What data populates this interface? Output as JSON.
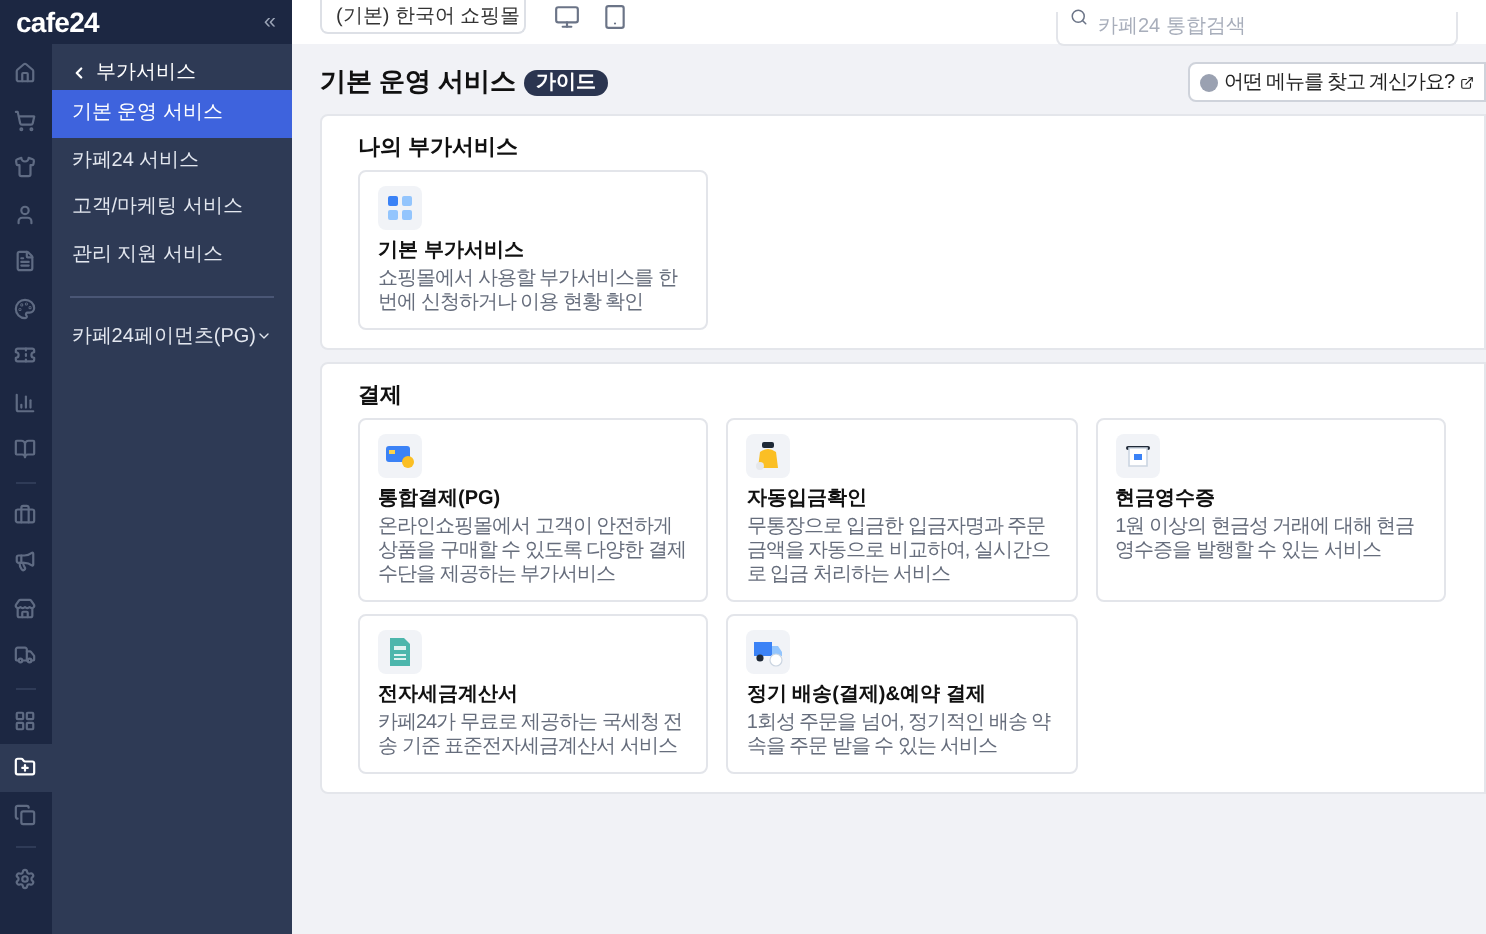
{
  "logo": "cafe24",
  "collapse": "«",
  "rail": {
    "groups": [
      {
        "items": [
          {
            "selected": false
          },
          {
            "selected": false
          },
          {
            "selected": false
          },
          {
            "selected": false
          },
          {
            "selected": false
          },
          {
            "selected": false
          },
          {
            "selected": false
          },
          {
            "selected": false
          },
          {
            "selected": false
          }
        ]
      },
      {
        "items": [
          {
            "selected": false
          },
          {
            "selected": false
          },
          {
            "selected": false
          },
          {
            "selected": false
          }
        ]
      },
      {
        "items": [
          {
            "selected": false
          },
          {
            "selected": true
          },
          {
            "selected": false
          }
        ]
      },
      {
        "items": [
          {
            "selected": false
          }
        ]
      }
    ]
  },
  "submenu": {
    "back": "부가서비스",
    "items": [
      {
        "label": "기본 운영 서비스",
        "selected": true
      },
      {
        "label": "카페24 서비스",
        "selected": false
      },
      {
        "label": "고객/마케팅 서비스",
        "selected": false
      },
      {
        "label": "관리 지원 서비스",
        "selected": false
      }
    ],
    "extra": [
      {
        "label": "카페24페이먼츠(PG)",
        "expanded": false
      }
    ]
  },
  "topbar": {
    "shop_select": "(기본) 한국어 쇼핑몰",
    "search": {
      "placeholder": "카페24 통합검색"
    }
  },
  "page": {
    "title": "기본 운영 서비스",
    "badge": "가이드",
    "help": "어떤 메뉴를 찾고 계신가요?"
  },
  "sections": [
    {
      "title": "나의 부가서비스",
      "cards": [
        {
          "kind": "grid",
          "title": "기본 부가서비스",
          "description": "쇼핑몰에서 사용할 부가서비스를 한 번에 신청하거나 이용 현황 확인"
        }
      ]
    },
    {
      "title": "결제",
      "cards": [
        {
          "kind": "card",
          "title": "통합결제(PG)",
          "description": "온라인쇼핑몰에서 고객이 안전하게 상품을 구매할 수 있도록 다양한 결제 수단을 제공하는 부가서비스"
        },
        {
          "kind": "bag",
          "title": "자동입금확인",
          "description": "무통장으로 입금한 입금자명과 주문금액을 자동으로 비교하여, 실시간으로 입금 처리하는 서비스"
        },
        {
          "kind": "receipt",
          "title": "현금영수증",
          "description": "1원 이상의 현금성 거래에 대해 현금영수증을 발행할 수 있는 서비스"
        },
        {
          "kind": "tax",
          "title": "전자세금계산서",
          "description": "카페24가 무료로 제공하는 국세청 전송 기준 표준전자세금계산서 서비스"
        },
        {
          "kind": "truck",
          "title": "정기 배송(결제)&예약 결제",
          "description": "1회성 주문을 넘어, 정기적인 배송 약속을 주문 받을 수 있는 서비스"
        }
      ]
    }
  ]
}
